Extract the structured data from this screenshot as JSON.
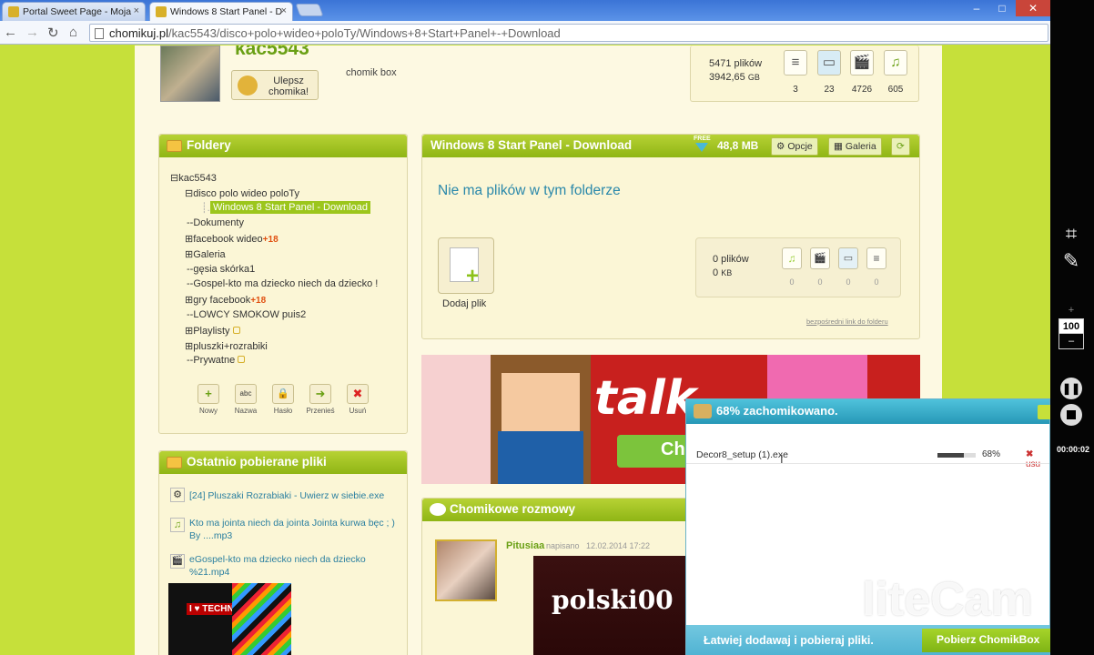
{
  "tabs": [
    {
      "title": "Portal Sweet Page - Moja",
      "close": "×"
    },
    {
      "title": "Windows 8 Start Panel - D",
      "close": "×"
    }
  ],
  "window_controls": {
    "minimize": "–",
    "restore": "□",
    "close": "✕"
  },
  "address": {
    "host": "chomikuj.pl",
    "path": "/kac5543/disco+polo+wideo+poloTy/Windows+8+Start+Panel+-+Download"
  },
  "profile": {
    "name": "kac5543",
    "upgrade_line1": "Ulepsz",
    "upgrade_line2": "chomika!",
    "box_label": "chomik box",
    "stats": {
      "files": "5471 plików",
      "size": "3942,65",
      "size_unit": "GB"
    },
    "type_counts": [
      "3",
      "23",
      "4726",
      "605"
    ]
  },
  "folders": {
    "title": "Foldery",
    "tree": [
      {
        "label": "kac5543",
        "prefix": "⊟"
      },
      {
        "label": "disco polo wideo poloTy",
        "prefix": "⊟"
      },
      {
        "label": "Windows 8 Start Panel - Download",
        "prefix": ""
      },
      {
        "label": "Dokumenty",
        "prefix": "--"
      },
      {
        "label": "facebook wideo",
        "prefix": "⊞",
        "badge": "+18"
      },
      {
        "label": "Galeria",
        "prefix": "⊞"
      },
      {
        "label": "gęsia skórka1",
        "prefix": "--"
      },
      {
        "label": "Gospel-kto ma dziecko niech da dziecko !",
        "prefix": "--"
      },
      {
        "label": "gry facebook",
        "prefix": "⊞",
        "badge": "+18"
      },
      {
        "label": "LOWCY SMOKOW puis2",
        "prefix": "--"
      },
      {
        "label": "Playlisty",
        "prefix": "⊞"
      },
      {
        "label": "pluszki+rozrabiki",
        "prefix": "⊞"
      },
      {
        "label": "Prywatne",
        "prefix": "--"
      }
    ],
    "tools": [
      {
        "label": "Nowy",
        "icon": "+"
      },
      {
        "label": "Nazwa",
        "icon": "abc"
      },
      {
        "label": "Hasło",
        "icon": "🔒"
      },
      {
        "label": "Przenieś",
        "icon": "➜"
      },
      {
        "label": "Usuń",
        "icon": "✖"
      }
    ]
  },
  "folder_view": {
    "title": "Windows 8 Start Panel - Download",
    "free": "FREE",
    "size": "48,8 MB",
    "options": "Opcje",
    "gallery": "Galeria",
    "empty_msg": "Nie ma plików w tym folderze",
    "add_file": "Dodaj plik",
    "summary": {
      "files": "0 plików",
      "size": "0",
      "unit": "KB",
      "counts": [
        "0",
        "0",
        "0",
        "0"
      ]
    },
    "direct_link": "bezpośredni link do folderu"
  },
  "banner": {
    "text": "talk",
    "button": "Ch"
  },
  "recent": {
    "title": "Ostatnio pobierane pliki",
    "items": [
      "[24] Pluszaki Rozrabiaki - Uwierz w siebie.exe",
      "Kto ma jointa niech da jointa Jointa kurwa bęc ; ) By ....mp3",
      "eGospel-kto ma dziecko niech da dziecko %21.mp4"
    ],
    "thumb_text": "I ♥ TECHNO"
  },
  "chat": {
    "title": "Chomikowe rozmowy",
    "user": "Pitusiaa",
    "wrote": "napisano",
    "date": "12.02.2014 17:22",
    "image_text": "polski00"
  },
  "download": {
    "status": "68% zachomikowano.",
    "file": "Decor8_setup (1).exe",
    "progress": 0.68,
    "percent": "68%",
    "cancel": "usu",
    "footer": "Łatwiej dodawaj i pobieraj pliki.",
    "footer_btn": "Pobierz ChomikBox"
  },
  "watermark": "liteCam",
  "recorder": {
    "zoom": "100",
    "plus": "+",
    "minus": "–",
    "time": "00:00:02"
  }
}
